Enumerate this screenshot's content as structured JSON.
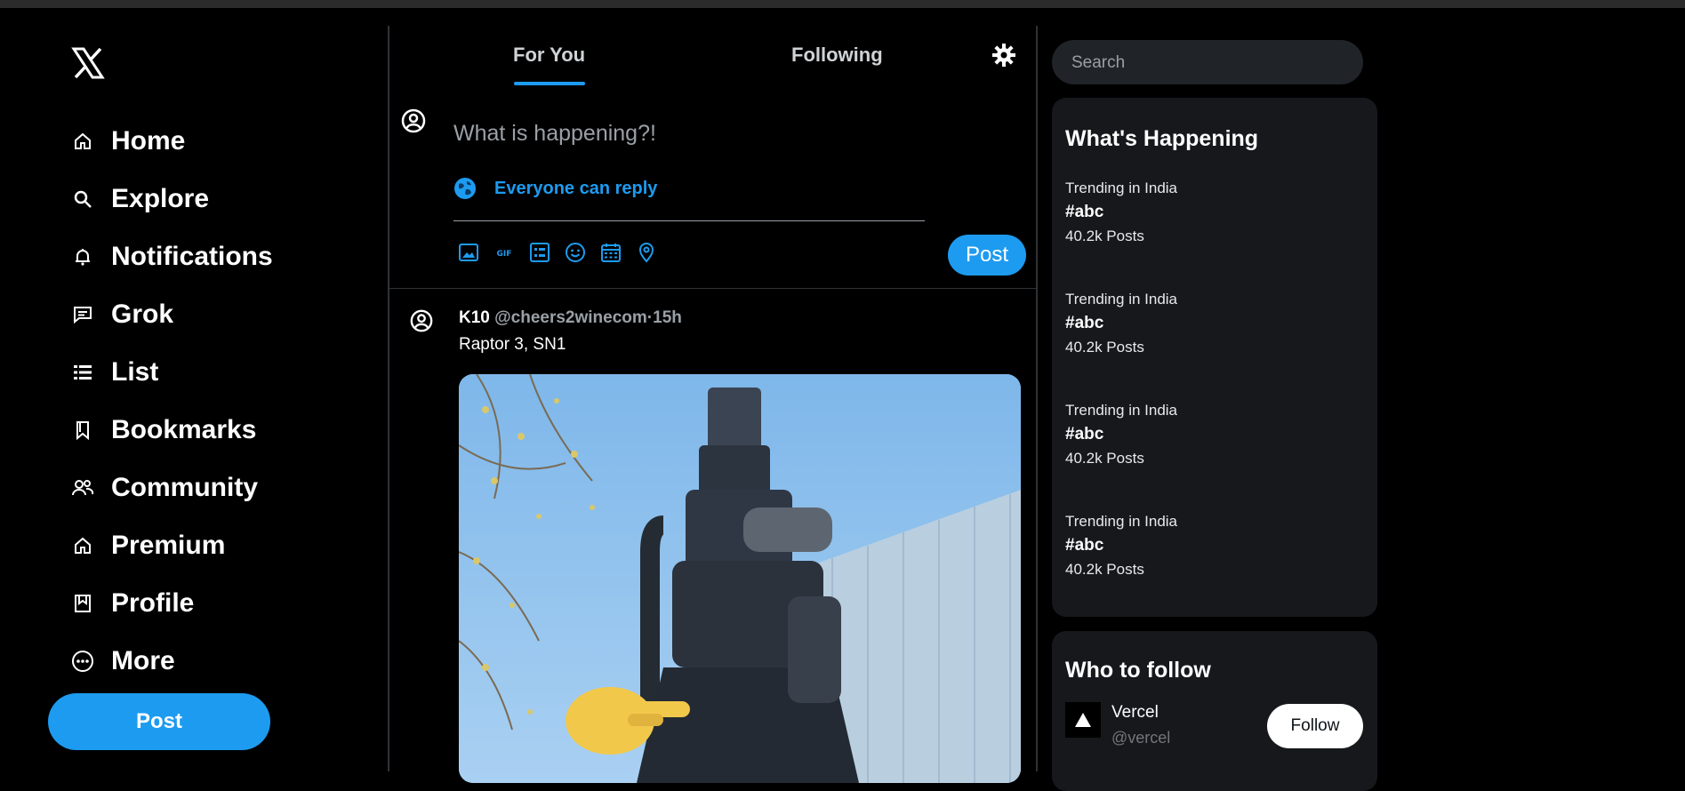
{
  "sidebar": {
    "logo_icon": "x-logo",
    "items": [
      {
        "label": "Home",
        "icon": "home-icon"
      },
      {
        "label": "Explore",
        "icon": "search-icon"
      },
      {
        "label": "Notifications",
        "icon": "bell-icon"
      },
      {
        "label": "Grok",
        "icon": "grok-icon"
      },
      {
        "label": "List",
        "icon": "list-icon"
      },
      {
        "label": "Bookmarks",
        "icon": "bookmark-icon"
      },
      {
        "label": "Community",
        "icon": "community-icon"
      },
      {
        "label": "Premium",
        "icon": "premium-icon"
      },
      {
        "label": "Profile",
        "icon": "profile-icon"
      },
      {
        "label": "More",
        "icon": "more-icon"
      }
    ],
    "post_label": "Post"
  },
  "main": {
    "tabs": [
      {
        "label": "For You",
        "active": true
      },
      {
        "label": "Following",
        "active": false
      }
    ],
    "settings_icon": "gear-icon",
    "composer": {
      "placeholder": "What is happening?!",
      "reply_setting": "Everyone can reply",
      "tools": [
        "image-icon",
        "gif-icon",
        "poll-icon",
        "emoji-icon",
        "schedule-icon",
        "location-icon"
      ],
      "post_label": "Post"
    },
    "tweet": {
      "name": "K10",
      "handle_time": "@cheers2winecom·15h",
      "text": "Raptor 3, SN1",
      "media_icon": "rocket-engine-photo"
    }
  },
  "right": {
    "search_placeholder": "Search",
    "happening": {
      "title": "What's Happening",
      "trends": [
        {
          "context": "Trending in India",
          "tag": "#abc",
          "count": "40.2k Posts"
        },
        {
          "context": "Trending in India",
          "tag": "#abc",
          "count": "40.2k Posts"
        },
        {
          "context": "Trending in India",
          "tag": "#abc",
          "count": "40.2k Posts"
        },
        {
          "context": "Trending in India",
          "tag": "#abc",
          "count": "40.2k Posts"
        }
      ]
    },
    "who_to_follow": {
      "title": "Who to follow",
      "accounts": [
        {
          "name": "Vercel",
          "handle": "@vercel",
          "follow_label": "Follow"
        }
      ]
    }
  },
  "colors": {
    "accent": "#1d9bf0",
    "background": "#000000",
    "card": "#16181c",
    "border": "#2f3336"
  }
}
